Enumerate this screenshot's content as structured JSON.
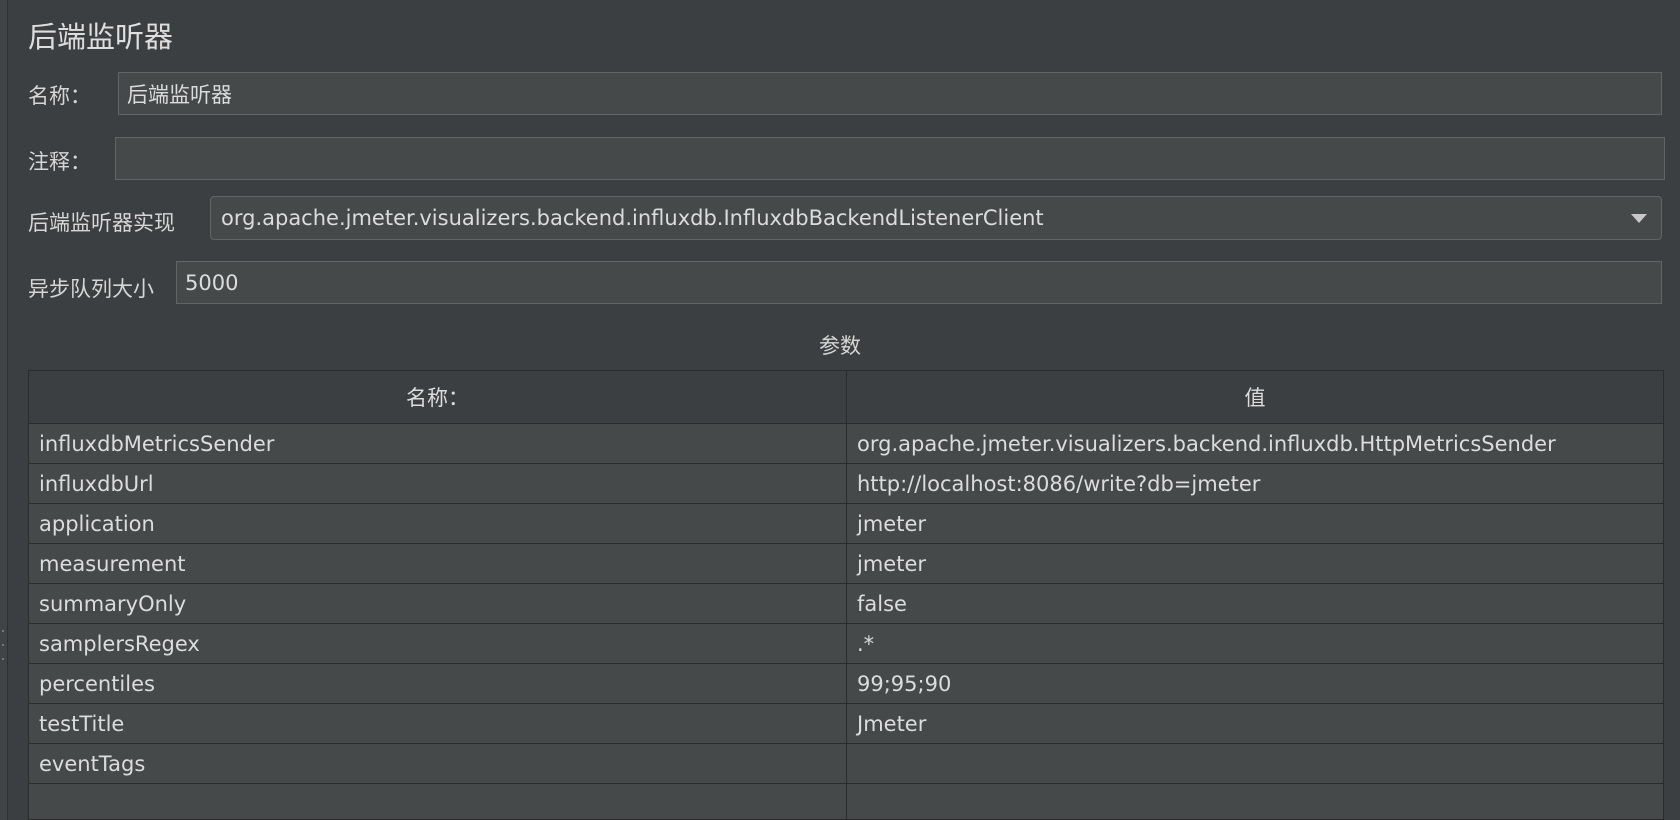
{
  "panel": {
    "title": "后端监听器"
  },
  "form": {
    "name_label": "名称：",
    "name_value": "后端监听器",
    "comment_label": "注释：",
    "comment_value": "",
    "impl_label": "后端监听器实现",
    "impl_value": "org.apache.jmeter.visualizers.backend.influxdb.InfluxdbBackendListenerClient",
    "queue_label": "异步队列大小",
    "queue_value": "5000"
  },
  "params": {
    "section_title": "参数",
    "columns": [
      "名称：",
      "值"
    ],
    "rows": [
      {
        "name": "influxdbMetricsSender",
        "value": "org.apache.jmeter.visualizers.backend.influxdb.HttpMetricsSender"
      },
      {
        "name": "influxdbUrl",
        "value": "http://localhost:8086/write?db=jmeter"
      },
      {
        "name": "application",
        "value": "jmeter"
      },
      {
        "name": "measurement",
        "value": "jmeter"
      },
      {
        "name": "summaryOnly",
        "value": "false"
      },
      {
        "name": "samplersRegex",
        "value": ".*"
      },
      {
        "name": "percentiles",
        "value": "99;95;90"
      },
      {
        "name": "testTitle",
        "value": "Jmeter"
      },
      {
        "name": "eventTags",
        "value": ""
      },
      {
        "name": "",
        "value": ""
      }
    ]
  },
  "icons": {
    "combo_arrow": "triangle-down-icon",
    "resize_handle": "drag-handle-icon"
  }
}
